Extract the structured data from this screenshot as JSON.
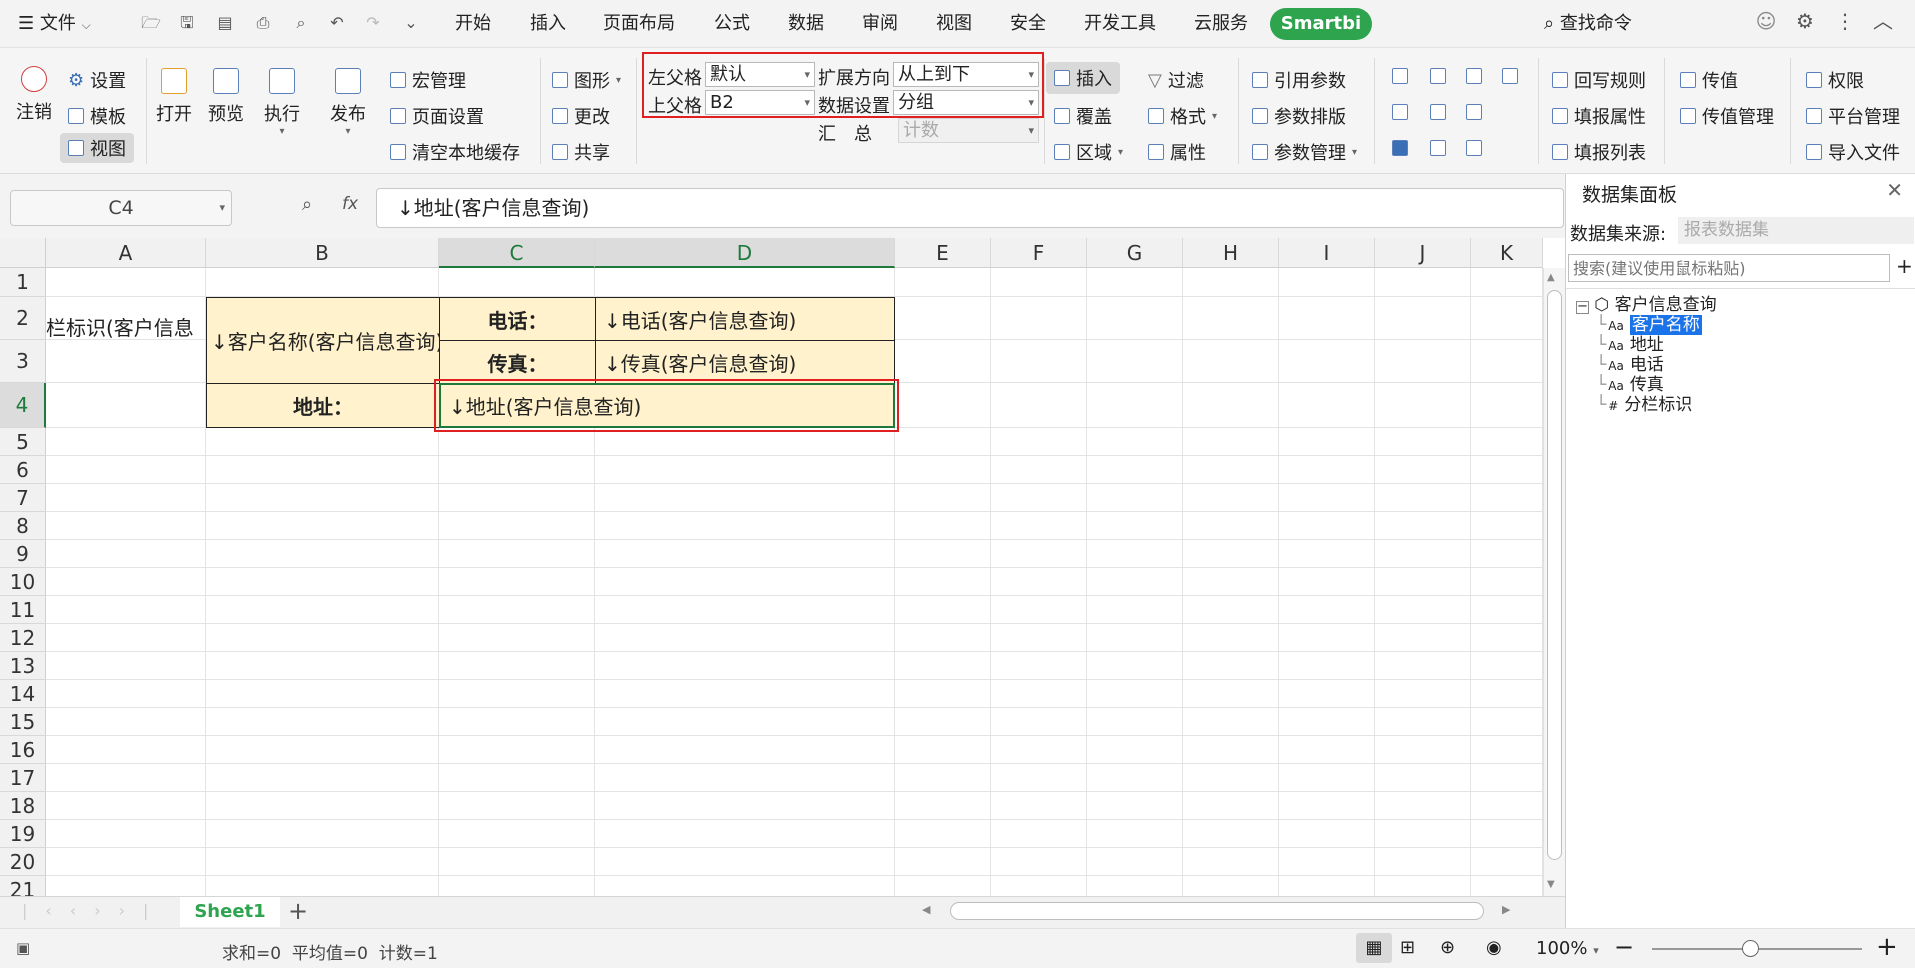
{
  "menu": {
    "file": "文件",
    "tabs": [
      "开始",
      "插入",
      "页面布局",
      "公式",
      "数据",
      "审阅",
      "视图",
      "安全",
      "开发工具",
      "云服务"
    ],
    "smartbi": "Smartbi",
    "search": "查找命令"
  },
  "ribbon": {
    "logout": "注销",
    "settings": "设置",
    "template": "模板",
    "view": "视图",
    "open": "打开",
    "preview": "预览",
    "execute": "执行",
    "publish": "发布",
    "macro": "宏管理",
    "page_setup": "页面设置",
    "clear_cache": "清空本地缓存",
    "chart": "图形",
    "change": "更改",
    "share": "共享",
    "left_parent_label": "左父格",
    "left_parent_value": "默认",
    "top_parent_label": "上父格",
    "top_parent_value": "B2",
    "expand_dir_label": "扩展方向",
    "expand_dir_value": "从上到下",
    "data_setting_label": "数据设置",
    "data_setting_value": "分组",
    "summary_label": "汇　总",
    "summary_value": "计数",
    "insert": "插入",
    "cover": "覆盖",
    "region": "区域",
    "filter": "过滤",
    "format": "格式",
    "property": "属性",
    "ref_param": "引用参数",
    "param_layout": "参数排版",
    "param_manage": "参数管理",
    "writeback_rule": "回写规则",
    "fill_property": "填报属性",
    "fill_list": "填报列表",
    "pass_value": "传值",
    "pass_value_manage": "传值管理",
    "permission": "权限",
    "platform_manage": "平台管理",
    "import_file": "导入文件"
  },
  "formula": {
    "namebox": "C4",
    "fx": "fx",
    "content": "↓地址(客户信息查询)"
  },
  "grid": {
    "columns": [
      "A",
      "B",
      "C",
      "D",
      "E",
      "F",
      "G",
      "H",
      "I",
      "J",
      "K"
    ],
    "selected_column": "C",
    "rows": [
      "1",
      "2",
      "3",
      "4",
      "5",
      "6",
      "7",
      "8",
      "9",
      "10",
      "11",
      "12",
      "13",
      "14",
      "15",
      "16",
      "17",
      "18",
      "19",
      "20",
      "21"
    ],
    "selected_row": "4",
    "cells": {
      "A2": "栏标识(客户信息",
      "B2": "↓客户名称(客户信息查询)",
      "C2": "电话：",
      "D2": "↓电话(客户信息查询)",
      "C3": "传真：",
      "D3": "↓传真(客户信息查询)",
      "B4": "地址：",
      "C4": "↓地址(客户信息查询)"
    }
  },
  "panel": {
    "title": "数据集面板",
    "source_label": "数据集来源:",
    "source_value": "报表数据集",
    "search_placeholder": "搜索(建议使用鼠标粘贴)",
    "root": "客户信息查询",
    "fields": [
      {
        "icon": "Aa",
        "name": "客户名称",
        "selected": true
      },
      {
        "icon": "Aa",
        "name": "地址"
      },
      {
        "icon": "Aa",
        "name": "电话"
      },
      {
        "icon": "Aa",
        "name": "传真"
      },
      {
        "icon": "#",
        "name": "分栏标识"
      }
    ]
  },
  "sheets": {
    "active": "Sheet1",
    "add": "+"
  },
  "status": {
    "summary": "求和=0  平均值=0  计数=1",
    "zoom": "100%",
    "minus": "−",
    "plus": "+"
  },
  "colors": {
    "accent_green": "#2ea44f",
    "cell_fill": "#fff2cc",
    "highlight_red": "#e02020",
    "selection_green": "#1e7a3c",
    "tree_selected": "#1a73e8"
  }
}
